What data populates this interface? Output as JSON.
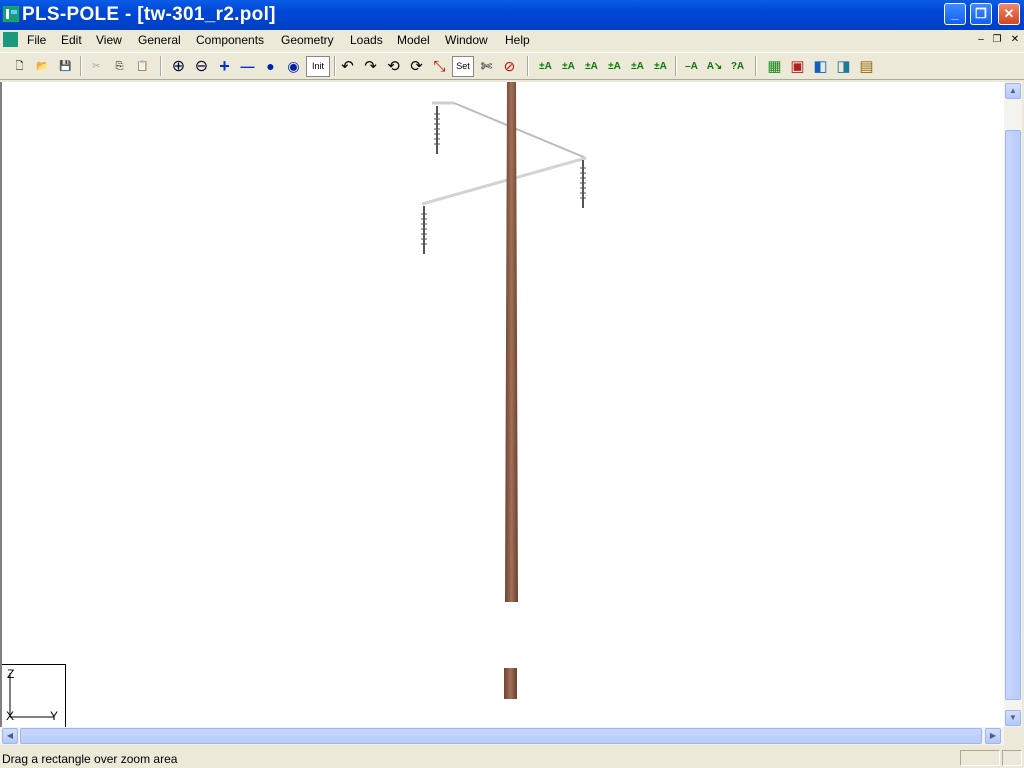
{
  "window": {
    "title": "PLS-POLE - [tw-301_r2.pol]",
    "minimize_glyph": "_",
    "maximize_glyph": "❐",
    "close_glyph": "✕"
  },
  "menu": {
    "items": [
      {
        "label": "File"
      },
      {
        "label": "Edit"
      },
      {
        "label": "View"
      },
      {
        "label": "General"
      },
      {
        "label": "Components"
      },
      {
        "label": "Geometry"
      },
      {
        "label": "Loads"
      },
      {
        "label": "Model"
      },
      {
        "label": "Window"
      },
      {
        "label": "Help"
      }
    ],
    "mdi_minimize": "–",
    "mdi_restore": "❐",
    "mdi_close": "✕"
  },
  "toolbar": {
    "buttons": [
      {
        "name": "new-file-icon",
        "glyph": "🗋"
      },
      {
        "name": "open-folder-icon",
        "glyph": "📂"
      },
      {
        "name": "save-icon",
        "glyph": "💾"
      },
      {
        "name": "cut-icon",
        "glyph": "✂"
      },
      {
        "name": "copy-icon",
        "glyph": "⎘"
      },
      {
        "name": "paste-icon",
        "glyph": "📋"
      },
      {
        "name": "zoom-in-icon",
        "glyph": "⊕"
      },
      {
        "name": "zoom-out-icon",
        "glyph": "⊖"
      },
      {
        "name": "plus-icon",
        "glyph": "+"
      },
      {
        "name": "minus-icon",
        "glyph": "—"
      },
      {
        "name": "rotate-icon",
        "glyph": "●"
      },
      {
        "name": "rotate-alt-icon",
        "glyph": "◉"
      },
      {
        "name": "init-button",
        "glyph": "Init"
      },
      {
        "name": "rotate-left-icon",
        "glyph": "↶"
      },
      {
        "name": "rotate-right-icon",
        "glyph": "↷"
      },
      {
        "name": "spin-left-icon",
        "glyph": "⟲"
      },
      {
        "name": "spin-right-icon",
        "glyph": "⟳"
      },
      {
        "name": "node-icon",
        "glyph": "⤡"
      },
      {
        "name": "set-button",
        "glyph": "Set"
      },
      {
        "name": "scissors-icon",
        "glyph": "✄"
      },
      {
        "name": "stop-icon",
        "glyph": "⊘"
      },
      {
        "name": "label-a1-icon",
        "glyph": "±A"
      },
      {
        "name": "label-a2-icon",
        "glyph": "±A"
      },
      {
        "name": "label-a3-icon",
        "glyph": "±A"
      },
      {
        "name": "label-a4-icon",
        "glyph": "±A"
      },
      {
        "name": "label-a5-icon",
        "glyph": "±A"
      },
      {
        "name": "label-a6-icon",
        "glyph": "±A"
      },
      {
        "name": "label-a7-icon",
        "glyph": "–A"
      },
      {
        "name": "label-a8-icon",
        "glyph": "A↘"
      },
      {
        "name": "query-a-icon",
        "glyph": "?A"
      },
      {
        "name": "view-3d-icon",
        "glyph": "▦"
      },
      {
        "name": "view-top-icon",
        "glyph": "▣"
      },
      {
        "name": "view-side-icon",
        "glyph": "◧"
      },
      {
        "name": "view-front-icon",
        "glyph": "◨"
      },
      {
        "name": "view-grid-icon",
        "glyph": "▤"
      }
    ]
  },
  "axes_indicator": {
    "z": "Z",
    "x": "X",
    "y": "Y"
  },
  "statusbar": {
    "message": "Drag a rectangle over zoom area"
  },
  "colors": {
    "pole": "#8b5a42",
    "crossarm": "#cfcfcf",
    "insulator": "#555555"
  }
}
